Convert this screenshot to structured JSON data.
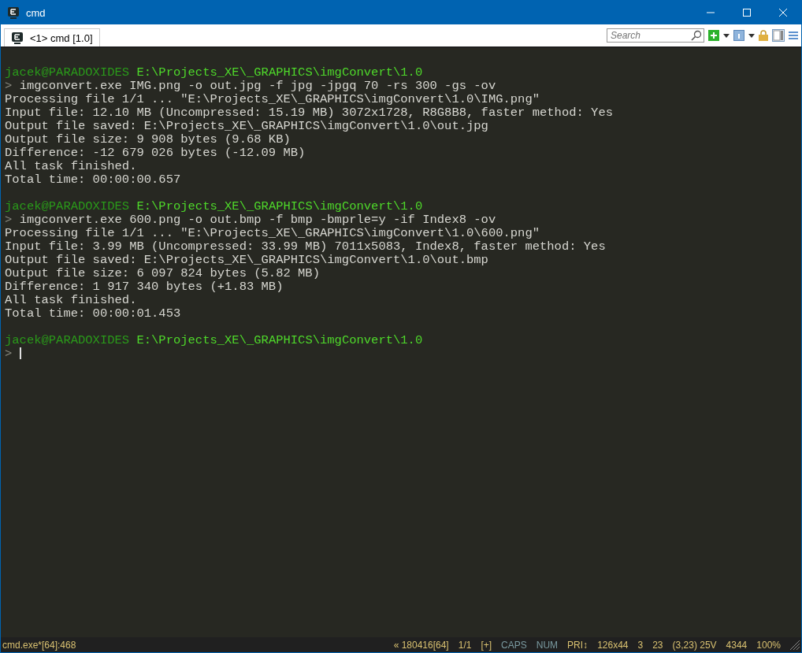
{
  "window": {
    "title": "cmd"
  },
  "tabs": [
    {
      "label": "<1> cmd [1.0]",
      "selected": true
    }
  ],
  "search": {
    "placeholder": "Search"
  },
  "terminal": {
    "lines": [
      {
        "kind": "blank"
      },
      {
        "kind": "prompt",
        "user": "jacek@PARADOXIDES",
        "path": "E:\\Projects_XE\\_GRAPHICS\\imgConvert\\1.0"
      },
      {
        "kind": "command",
        "marker": ">",
        "text": "imgconvert.exe IMG.png -o out.jpg -f jpg -jpgq 70 -rs 300 -gs -ov"
      },
      {
        "kind": "output",
        "text": "Processing file 1/1 ... \"E:\\Projects_XE\\_GRAPHICS\\imgConvert\\1.0\\IMG.png\""
      },
      {
        "kind": "output",
        "text": "Input file: 12.10 MB (Uncompressed: 15.19 MB) 3072x1728, R8G8B8, faster method: Yes"
      },
      {
        "kind": "output",
        "text": "Output file saved: E:\\Projects_XE\\_GRAPHICS\\imgConvert\\1.0\\out.jpg"
      },
      {
        "kind": "output",
        "text": "Output file size: 9 908 bytes (9.68 KB)"
      },
      {
        "kind": "output",
        "text": "Difference: -12 679 026 bytes (-12.09 MB)"
      },
      {
        "kind": "output",
        "text": "All task finished."
      },
      {
        "kind": "output",
        "text": "Total time: 00:00:00.657"
      },
      {
        "kind": "blank"
      },
      {
        "kind": "prompt",
        "user": "jacek@PARADOXIDES",
        "path": "E:\\Projects_XE\\_GRAPHICS\\imgConvert\\1.0"
      },
      {
        "kind": "command",
        "marker": ">",
        "text": "imgconvert.exe 600.png -o out.bmp -f bmp -bmprle=y -if Index8 -ov"
      },
      {
        "kind": "output",
        "text": "Processing file 1/1 ... \"E:\\Projects_XE\\_GRAPHICS\\imgConvert\\1.0\\600.png\""
      },
      {
        "kind": "output",
        "text": "Input file: 3.99 MB (Uncompressed: 33.99 MB) 7011x5083, Index8, faster method: Yes"
      },
      {
        "kind": "output",
        "text": "Output file saved: E:\\Projects_XE\\_GRAPHICS\\imgConvert\\1.0\\out.bmp"
      },
      {
        "kind": "output",
        "text": "Output file size: 6 097 824 bytes (5.82 MB)"
      },
      {
        "kind": "output",
        "text": "Difference: 1 917 340 bytes (+1.83 MB)"
      },
      {
        "kind": "output",
        "text": "All task finished."
      },
      {
        "kind": "output",
        "text": "Total time: 00:00:01.453"
      },
      {
        "kind": "blank"
      },
      {
        "kind": "prompt",
        "user": "jacek@PARADOXIDES",
        "path": "E:\\Projects_XE\\_GRAPHICS\\imgConvert\\1.0"
      },
      {
        "kind": "cursor",
        "marker": ">"
      }
    ]
  },
  "status_bar": {
    "left": "cmd.exe*[64]:468",
    "items": [
      {
        "text": "« 180416[64]",
        "on": true
      },
      {
        "text": "1/1",
        "on": true
      },
      {
        "text": "[+]",
        "on": true
      },
      {
        "text": "CAPS",
        "on": false
      },
      {
        "text": "NUM",
        "on": false
      },
      {
        "text": "PRI↕",
        "on": true
      },
      {
        "text": "126x44",
        "on": true
      },
      {
        "text": "3",
        "on": true
      },
      {
        "text": "23",
        "on": true
      },
      {
        "text": "(3,23) 25V",
        "on": true
      },
      {
        "text": "4344",
        "on": true
      },
      {
        "text": "100%",
        "on": true
      }
    ]
  }
}
